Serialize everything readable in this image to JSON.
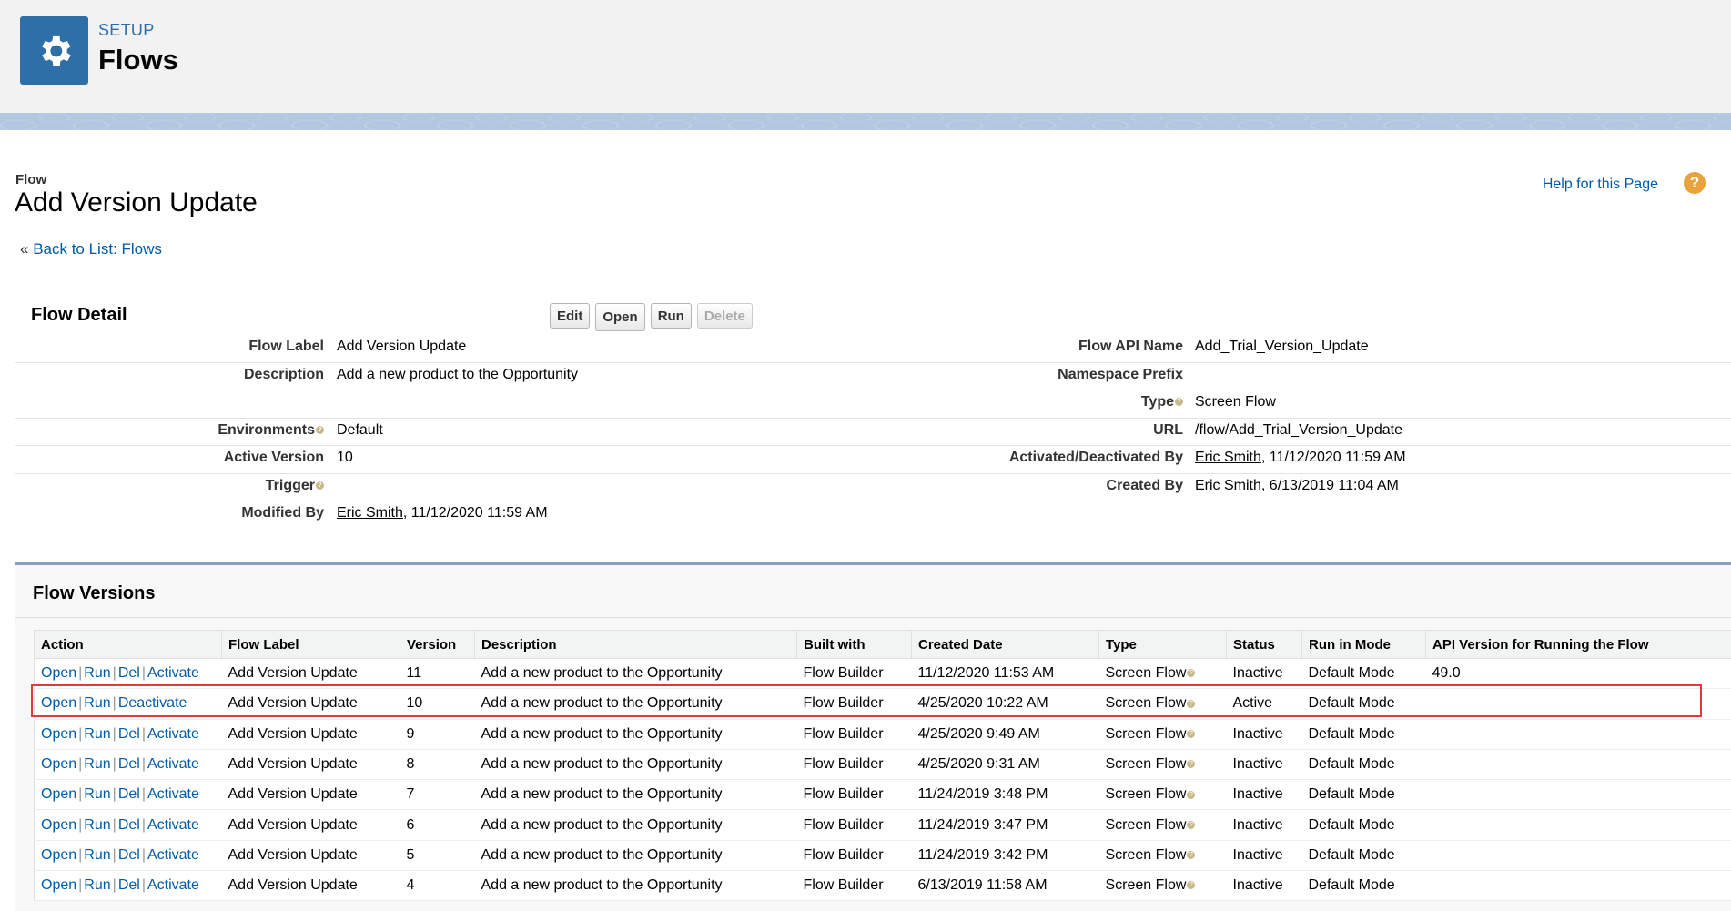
{
  "header": {
    "kicker": "SETUP",
    "title": "Flows",
    "icon": "gear-icon",
    "icon_bg": "#2e6fa7"
  },
  "page": {
    "object_label": "Flow",
    "record_name": "Add Version Update",
    "back_prefix": "« ",
    "back_link": "Back to List: Flows",
    "help_link": "Help for this Page",
    "help_icon": "?"
  },
  "detail": {
    "title": "Flow Detail",
    "buttons": {
      "edit": "Edit",
      "open": "Open",
      "run": "Run",
      "delete": "Delete"
    },
    "rows": [
      {
        "l1": "Flow Label",
        "v1": "Add Version Update",
        "l2": "Flow API Name",
        "v2": "Add_Trial_Version_Update"
      },
      {
        "l1": "Description",
        "v1": "Add a new product to the Opportunity",
        "l2": "Namespace Prefix",
        "v2": ""
      },
      {
        "l1": "",
        "v1": "",
        "l2": "Type",
        "v2": "Screen Flow"
      },
      {
        "l1": "Environments",
        "v1": "Default",
        "l2": "URL",
        "v2": "/flow/Add_Trial_Version_Update"
      },
      {
        "l1": "Active Version",
        "v1": "10",
        "l2": "Activated/Deactivated By",
        "v2_user": "Eric Smith",
        "v2": ", 11/12/2020 11:59 AM"
      },
      {
        "l1": "Trigger",
        "v1": "",
        "l2": "Created By",
        "v2_user": "Eric Smith",
        "v2": ", 6/13/2019 11:04 AM"
      },
      {
        "l1": "Modified By",
        "v1_user": "Eric Smith",
        "v1": ", 11/12/2020 11:59 AM",
        "l2": "",
        "v2": ""
      }
    ]
  },
  "versions": {
    "title": "Flow Versions",
    "columns": [
      "Action",
      "Flow Label",
      "Version",
      "Description",
      "Built with",
      "Created Date",
      "Type",
      "Status",
      "Run in Mode",
      "API Version for Running the Flow"
    ],
    "action_labels": {
      "open": "Open",
      "run": "Run",
      "del": "Del",
      "activate": "Activate",
      "deactivate": "Deactivate",
      "sep": "|"
    },
    "rows": [
      {
        "label": "Add Version Update",
        "version": "11",
        "description": "Add a new product to the Opportunity",
        "built_with": "Flow Builder",
        "created": "11/12/2020 11:53 AM",
        "type": "Screen Flow",
        "status": "Inactive",
        "mode": "Default Mode",
        "api": "49.0"
      },
      {
        "label": "Add Version Update",
        "version": "10",
        "description": "Add a new product to the Opportunity",
        "built_with": "Flow Builder",
        "created": "4/25/2020 10:22 AM",
        "type": "Screen Flow",
        "status": "Active",
        "mode": "Default Mode",
        "api": ""
      },
      {
        "label": "Add Version Update",
        "version": "9",
        "description": "Add a new product to the Opportunity",
        "built_with": "Flow Builder",
        "created": "4/25/2020 9:49 AM",
        "type": "Screen Flow",
        "status": "Inactive",
        "mode": "Default Mode",
        "api": ""
      },
      {
        "label": "Add Version Update",
        "version": "8",
        "description": "Add a new product to the Opportunity",
        "built_with": "Flow Builder",
        "created": "4/25/2020 9:31 AM",
        "type": "Screen Flow",
        "status": "Inactive",
        "mode": "Default Mode",
        "api": ""
      },
      {
        "label": "Add Version Update",
        "version": "7",
        "description": "Add a new product to the Opportunity",
        "built_with": "Flow Builder",
        "created": "11/24/2019 3:48 PM",
        "type": "Screen Flow",
        "status": "Inactive",
        "mode": "Default Mode",
        "api": ""
      },
      {
        "label": "Add Version Update",
        "version": "6",
        "description": "Add a new product to the Opportunity",
        "built_with": "Flow Builder",
        "created": "11/24/2019 3:47 PM",
        "type": "Screen Flow",
        "status": "Inactive",
        "mode": "Default Mode",
        "api": ""
      },
      {
        "label": "Add Version Update",
        "version": "5",
        "description": "Add a new product to the Opportunity",
        "built_with": "Flow Builder",
        "created": "11/24/2019 3:42 PM",
        "type": "Screen Flow",
        "status": "Inactive",
        "mode": "Default Mode",
        "api": ""
      },
      {
        "label": "Add Version Update",
        "version": "4",
        "description": "Add a new product to the Opportunity",
        "built_with": "Flow Builder",
        "created": "6/13/2019 11:58 AM",
        "type": "Screen Flow",
        "status": "Inactive",
        "mode": "Default Mode",
        "api": ""
      }
    ]
  },
  "highlight_color": "#e0393e",
  "link_color": "#015ba7"
}
